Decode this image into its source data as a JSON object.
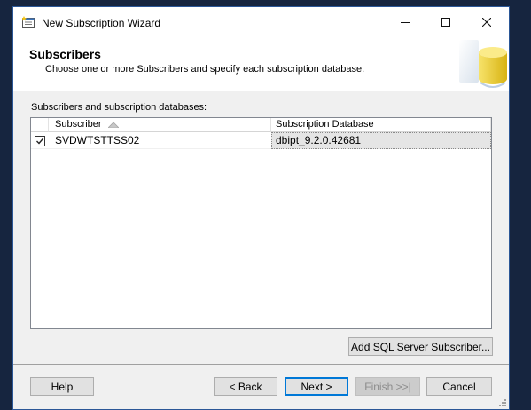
{
  "window": {
    "title": "New Subscription Wizard"
  },
  "header": {
    "title": "Subscribers",
    "subtitle": "Choose one or more Subscribers and specify each subscription database."
  },
  "grid": {
    "label": "Subscribers and subscription databases:",
    "columns": [
      "Subscriber",
      "Subscription Database"
    ],
    "sort_indicator": "ascending",
    "rows": [
      {
        "checked": true,
        "subscriber": "SVDWTSTTSS02",
        "database": "dbipt_9.2.0.42681"
      }
    ]
  },
  "buttons": {
    "add_subscriber": "Add SQL Server Subscriber...",
    "help": "Help",
    "back": "< Back",
    "next": "Next >",
    "finish": "Finish >>|",
    "cancel": "Cancel"
  },
  "icons": {
    "app": "wizard-app-icon",
    "minimize": "minimize-icon",
    "maximize": "maximize-icon",
    "close": "close-icon",
    "header_image": "database-cylinder-icon",
    "sort": "sort-ascending-icon",
    "checkbox": "checkbox-checked-icon",
    "grip": "resize-grip-icon"
  },
  "colors": {
    "desktop": "#16253f",
    "window_border": "#2b5797",
    "default_button_border": "#0078d7",
    "selected_cell": "#e5e5e5"
  }
}
